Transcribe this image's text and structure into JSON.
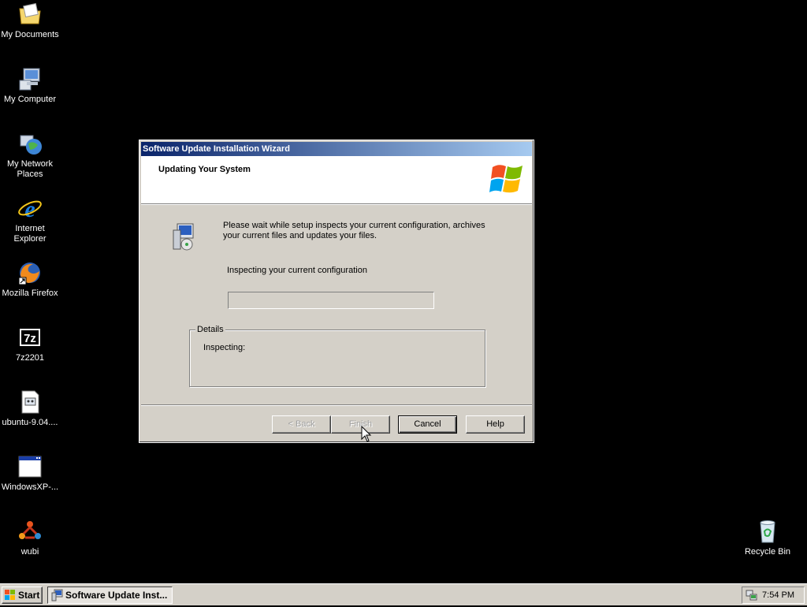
{
  "desktop": {
    "icons": [
      {
        "label": "My Documents"
      },
      {
        "label": "My Computer"
      },
      {
        "label": "My Network\nPlaces"
      },
      {
        "label": "Internet\nExplorer"
      },
      {
        "label": "Mozilla Firefox"
      },
      {
        "label": "7z2201"
      },
      {
        "label": "ubuntu-9.04...."
      },
      {
        "label": "WindowsXP-..."
      },
      {
        "label": "wubi"
      },
      {
        "label": "Recycle Bin"
      }
    ]
  },
  "wizard": {
    "title": "Software Update Installation Wizard",
    "header_title": "Updating Your System",
    "intro_text": "Please wait while setup inspects your current configuration, archives your current files and updates your files.",
    "status_text": "Inspecting your current configuration",
    "progress_fraction": 0,
    "details_legend": "Details",
    "details_text": "Inspecting:",
    "buttons": {
      "back": "< Back",
      "finish": "Finish",
      "cancel": "Cancel",
      "help": "Help"
    }
  },
  "taskbar": {
    "start_label": "Start",
    "task_label": "Software Update Inst...",
    "clock": "7:54 PM"
  },
  "colors": {
    "titlebar_start": "#0a246a",
    "titlebar_end": "#a6caf0",
    "dialog_face": "#d4d0c8",
    "desktop_bg": "#000000"
  }
}
